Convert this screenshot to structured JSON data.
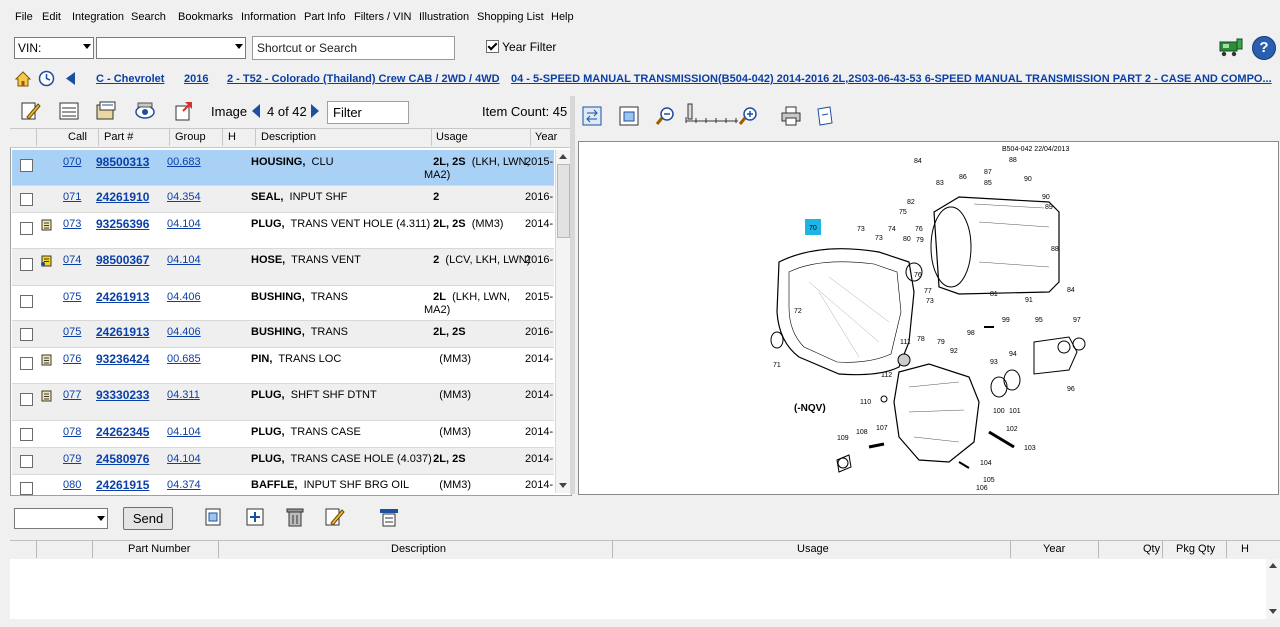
{
  "menu": [
    "File",
    "Edit",
    "Integration",
    "Search",
    "Bookmarks",
    "Information",
    "Part Info",
    "Filters / VIN",
    "Illustration",
    "Shopping List",
    "Help"
  ],
  "vin": {
    "select_label": "VIN:",
    "search_placeholder": "Shortcut or Search",
    "year_filter_label": "Year Filter",
    "year_filter_checked": true
  },
  "breadcrumb": [
    "C - Chevrolet",
    "2016",
    "2 - T52 - Colorado (Thailand) Crew CAB  / 2WD  / 4WD",
    "04 - 5-SPEED MANUAL TRANSMISSION",
    "(B504-042)  2014-2016  2L,2S03-06-43-53 6-SPEED MANUAL TRANSMISSION PART 2 - CASE AND COMPO..."
  ],
  "parts_toolbar": {
    "image_label": "Image",
    "image_position": "4 of 42",
    "filter_placeholder": "Filter",
    "item_count_label": "Item Count: 45"
  },
  "columns": [
    "Call",
    "Part #",
    "Group",
    "H",
    "Description",
    "Usage",
    "Year"
  ],
  "rows": [
    {
      "call": "070",
      "part": "98500313",
      "group": "00.683",
      "desc_bold": "HOUSING,",
      "desc": "CLU",
      "usage_bold": "2L, 2S",
      "usage": "(LKH, LWN, MA2)",
      "year": "2015-",
      "note": "",
      "selected": true
    },
    {
      "call": "071",
      "part": "24261910",
      "group": "04.354",
      "desc_bold": "SEAL,",
      "desc": "INPUT SHF",
      "usage_bold": "2",
      "usage": "",
      "year": "2016-",
      "note": ""
    },
    {
      "call": "073",
      "part": "93256396",
      "group": "04.104",
      "desc_bold": "PLUG,",
      "desc": "TRANS VENT HOLE (4.311)",
      "usage_bold": "2L, 2S",
      "usage": "(MM3)",
      "year": "2014-",
      "note": "note"
    },
    {
      "call": "074",
      "part": "98500367",
      "group": "04.104",
      "desc_bold": "HOSE,",
      "desc": "TRANS VENT",
      "usage_bold": "2",
      "usage": "(LCV, LKH, LWN)",
      "year": "2016-",
      "note": "note-yellow"
    },
    {
      "call": "075",
      "part": "24261913",
      "group": "04.406",
      "desc_bold": "BUSHING,",
      "desc": "TRANS",
      "usage_bold": "2L",
      "usage": "(LKH, LWN, MA2)",
      "year": "2015-",
      "note": ""
    },
    {
      "call": "075",
      "part": "24261913",
      "group": "04.406",
      "desc_bold": "BUSHING,",
      "desc": "TRANS",
      "usage_bold": "2L, 2S",
      "usage": "",
      "year": "2016-",
      "note": ""
    },
    {
      "call": "076",
      "part": "93236424",
      "group": "00.685",
      "desc_bold": "PIN,",
      "desc": "TRANS LOC",
      "usage_bold": "",
      "usage": "(MM3)",
      "year": "2014-",
      "note": "note"
    },
    {
      "call": "077",
      "part": "93330233",
      "group": "04.311",
      "desc_bold": "PLUG,",
      "desc": "SHFT SHF DTNT",
      "usage_bold": "",
      "usage": "(MM3)",
      "year": "2014-",
      "note": "note"
    },
    {
      "call": "078",
      "part": "24262345",
      "group": "04.104",
      "desc_bold": "PLUG,",
      "desc": "TRANS CASE",
      "usage_bold": "",
      "usage": "(MM3)",
      "year": "2014-",
      "note": ""
    },
    {
      "call": "079",
      "part": "24580976",
      "group": "04.104",
      "desc_bold": "PLUG,",
      "desc": "TRANS CASE HOLE (4.037)",
      "usage_bold": "2L, 2S",
      "usage": "",
      "year": "2014-",
      "note": ""
    },
    {
      "call": "080",
      "part": "24261915",
      "group": "04.374",
      "desc_bold": "BAFFLE,",
      "desc": "INPUT SHF BRG OIL",
      "usage_bold": "",
      "usage": "(MM3)",
      "year": "2014-",
      "note": ""
    }
  ],
  "illustration": {
    "header": "B504-042  22/04/2013",
    "variant_label": "(-NQV)",
    "highlighted_callout": "70",
    "callouts": [
      "84",
      "83",
      "87",
      "88",
      "86",
      "85",
      "90",
      "90",
      "89",
      "75",
      "82",
      "76",
      "80",
      "74",
      "73",
      "73",
      "79",
      "88",
      "84",
      "81",
      "91",
      "76",
      "77",
      "73",
      "72",
      "71",
      "78",
      "79",
      "99",
      "98",
      "97",
      "95",
      "96",
      "111",
      "112",
      "92",
      "93",
      "94",
      "110",
      "100",
      "101",
      "102",
      "103",
      "104",
      "105",
      "106",
      "107",
      "108",
      "109"
    ]
  },
  "bottom": {
    "send_label": "Send",
    "columns": [
      "Part Number",
      "Description",
      "Usage",
      "Year",
      "Qty",
      "Pkg Qty",
      "H"
    ]
  },
  "colors": {
    "link": "#0a3fa8",
    "selected_row": "#a9d1f5",
    "callout_highlight": "#1fb4e6"
  }
}
